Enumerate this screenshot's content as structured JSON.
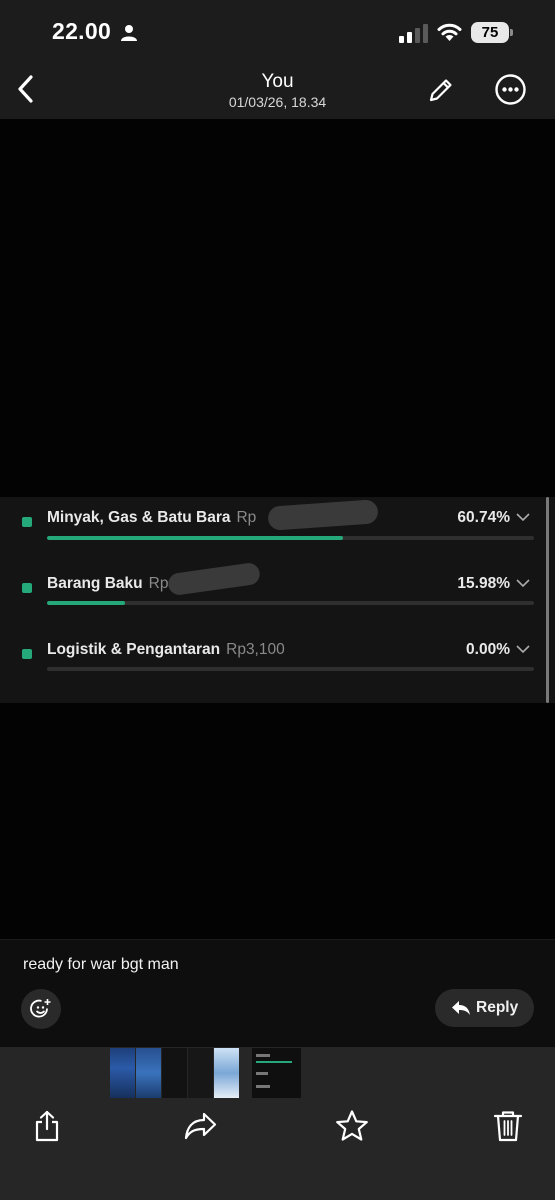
{
  "status_bar": {
    "time": "22.00",
    "battery": "75"
  },
  "header": {
    "title": "You",
    "subtitle": "01/03/26, 18.34"
  },
  "allocation_rows": [
    {
      "label": "Minyak, Gas & Batu Bara",
      "amount": "Rp",
      "percent": "60.74%",
      "fraction": 0.6074
    },
    {
      "label": "Barang Baku",
      "amount": "Rp",
      "percent": "15.98%",
      "fraction": 0.1598
    },
    {
      "label": "Logistik & Pengantaran",
      "amount": "Rp3,100",
      "percent": "0.00%",
      "fraction": 0.0
    }
  ],
  "caption": {
    "text": "ready for war bgt man",
    "reply_label": "Reply"
  },
  "colors": {
    "accent": "#25a97b",
    "background": "#000000",
    "bar_background": "#1c1c1c",
    "toolbar": "#262626"
  },
  "icons": [
    "back-chevron-icon",
    "pencil-icon",
    "more-icon",
    "emoji-add-icon",
    "reply-arrow-icon",
    "share-icon",
    "forward-icon",
    "star-icon",
    "trash-icon"
  ]
}
